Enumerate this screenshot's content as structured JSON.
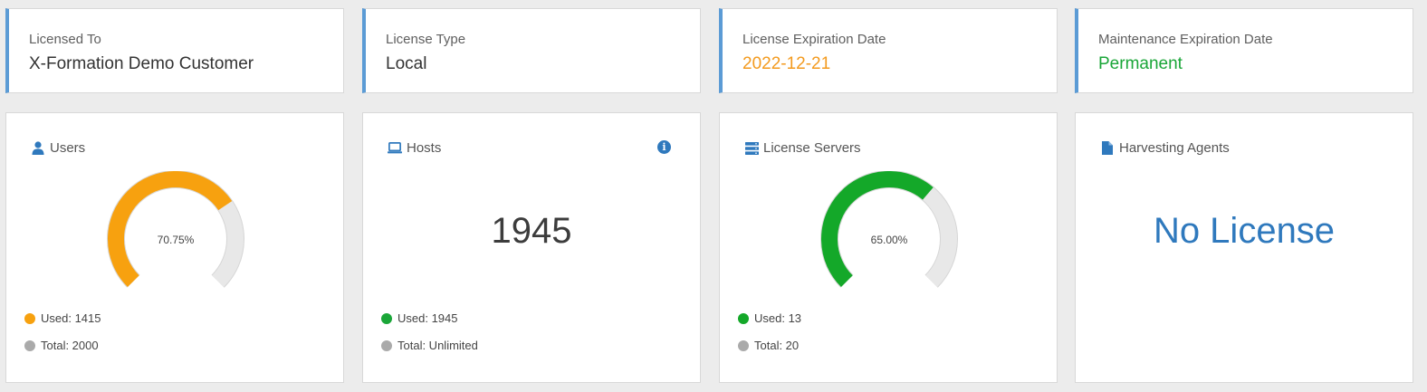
{
  "info_cards": [
    {
      "label": "Licensed To",
      "value": "X-Formation Demo Customer",
      "value_color": "#333333"
    },
    {
      "label": "License Type",
      "value": "Local",
      "value_color": "#333333"
    },
    {
      "label": "License Expiration Date",
      "value": "2022-12-21",
      "value_color": "#f39a1e"
    },
    {
      "label": "Maintenance Expiration Date",
      "value": "Permanent",
      "value_color": "#1aa638"
    }
  ],
  "users": {
    "title": "Users",
    "icon": "user-icon",
    "percent_label": "70.75%",
    "fraction": 0.7075,
    "color": "#f7a10f",
    "used_label": "Used: 1415",
    "total_label": "Total: 2000"
  },
  "hosts": {
    "title": "Hosts",
    "icon": "laptop-icon",
    "info_icon": "info-icon",
    "value": "1945",
    "used_label": "Used: 1945",
    "total_label": "Total: Unlimited",
    "color": "#1aa638"
  },
  "license_servers": {
    "title": "License Servers",
    "icon": "server-icon",
    "percent_label": "65.00%",
    "fraction": 0.65,
    "color": "#14a829",
    "used_label": "Used: 13",
    "total_label": "Total: 20"
  },
  "harvesting_agents": {
    "title": "Harvesting Agents",
    "icon": "file-icon",
    "status": "No License"
  },
  "colors": {
    "accent_border": "#5b9bd5",
    "icon_blue": "#2f79bd",
    "track_gray": "#e6e6e6",
    "total_dot": "#aaaaaa"
  }
}
